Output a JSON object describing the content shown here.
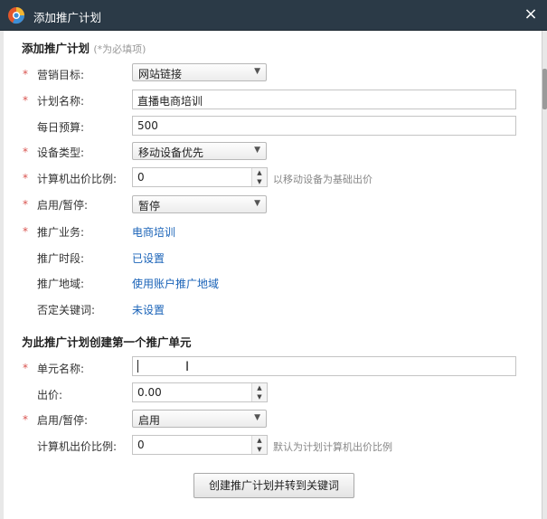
{
  "window": {
    "title": "添加推广计划",
    "close_glyph": "×",
    "accent_color": "#2b3a47"
  },
  "plan_section": {
    "title": "添加推广计划",
    "hint": "(*为必填项)"
  },
  "fields": {
    "marketing_goal": {
      "label": "营销目标:",
      "value": "网站链接"
    },
    "plan_name": {
      "label": "计划名称:",
      "value": "直播电商培训"
    },
    "daily_budget": {
      "label": "每日预算:",
      "value": "500"
    },
    "device_type": {
      "label": "设备类型:",
      "value": "移动设备优先"
    },
    "pc_bid_ratio": {
      "label": "计算机出价比例:",
      "value": "0",
      "note": "以移动设备为基础出价"
    },
    "status": {
      "label": "启用/暂停:",
      "value": "暂停"
    },
    "business": {
      "label": "推广业务:",
      "link": "电商培训"
    },
    "schedule": {
      "label": "推广时段:",
      "link": "已设置"
    },
    "region": {
      "label": "推广地域:",
      "link": "使用账户推广地域"
    },
    "negative_keywords": {
      "label": "否定关键词:",
      "link": "未设置"
    }
  },
  "unit_section": {
    "title": "为此推广计划创建第一个推广单元"
  },
  "unit_fields": {
    "unit_name": {
      "label": "单元名称:",
      "value": ""
    },
    "bid": {
      "label": "出价:",
      "value": "0.00"
    },
    "status": {
      "label": "启用/暂停:",
      "value": "启用"
    },
    "pc_bid_ratio": {
      "label": "计算机出价比例:",
      "value": "0",
      "note": "默认为计划计算机出价比例"
    }
  },
  "actions": {
    "submit_label": "创建推广计划并转到关键词"
  },
  "required_mark": "*",
  "spin_up": "▲",
  "spin_down": "▼",
  "select_arrow": "▼"
}
